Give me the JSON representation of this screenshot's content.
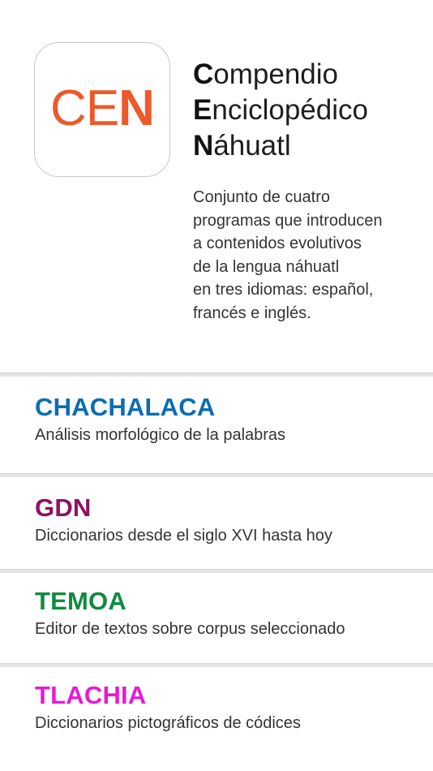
{
  "app": {
    "icon": {
      "letters": [
        "C",
        "E",
        "N"
      ],
      "color": "#ec5a2b"
    },
    "title_lines": [
      {
        "initial": "C",
        "rest": "ompendio"
      },
      {
        "initial": "E",
        "rest": "nciclopédico"
      },
      {
        "initial": "N",
        "rest": "áhuatl"
      }
    ],
    "description_lines": [
      "Conjunto de cuatro",
      "programas que introducen",
      "a contenidos evolutivos",
      "de la lengua náhuatl",
      "en tres idiomas: español,",
      "francés e inglés."
    ]
  },
  "programs": [
    {
      "name": "CHACHALACA",
      "description": "Análisis morfológico de la palabras",
      "color": "#0a6db3"
    },
    {
      "name": "GDN",
      "description": "Diccionarios desde el siglo XVI hasta hoy",
      "color": "#8e1162"
    },
    {
      "name": "TEMOA",
      "description": "Editor de textos sobre corpus seleccionado",
      "color": "#0f8a3d"
    },
    {
      "name": "TLACHIA",
      "description": "Diccionarios pictográficos de códices",
      "color": "#e51ad6"
    }
  ]
}
